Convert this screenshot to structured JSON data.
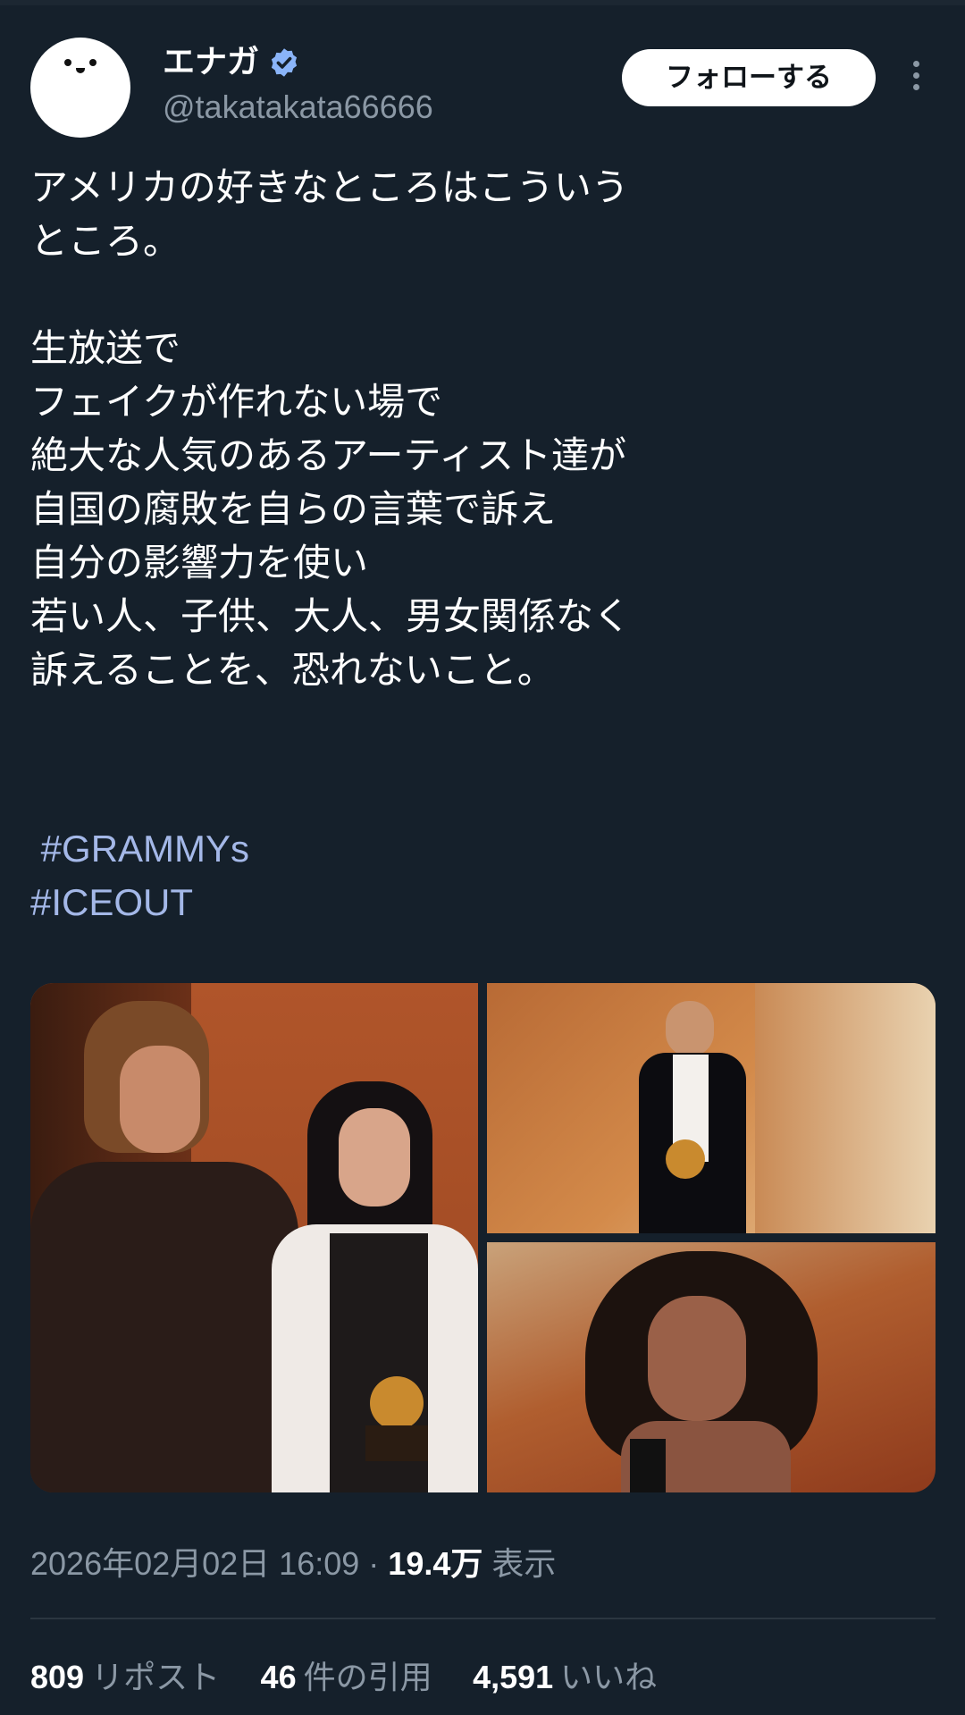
{
  "user": {
    "display_name": "エナガ",
    "handle": "@takatakata66666",
    "follow_label": "フォローする"
  },
  "tweet": {
    "lines": [
      "アメリカの好きなところはこういう",
      "ところ。",
      "",
      "生放送で",
      "フェイクが作れない場で",
      "絶大な人気のあるアーティスト達が",
      "自国の腐敗を自らの言葉で訴え",
      "自分の影響力を使い",
      "若い人、子供、大人、男女関係なく",
      "訴えることを、恐れないこと。"
    ],
    "hashtags": [
      " #GRAMMYs",
      "#ICEOUT"
    ]
  },
  "meta": {
    "timestamp": "2026年02月02日 16:09",
    "separator": "·",
    "views_count": "19.4万",
    "views_label": "表示"
  },
  "stats": {
    "reposts_count": "809",
    "reposts_label": "リポスト",
    "quotes_count": "46",
    "quotes_label": "件の引用",
    "likes_count": "4,591",
    "likes_label": "いいね"
  },
  "colors": {
    "background": "#15202b",
    "hashtag": "#a4b8e8",
    "secondary_text": "#8b98a5",
    "verified": "#8ab4f8"
  },
  "icons": {
    "verified": "verified-badge-icon",
    "more": "more-options-icon"
  }
}
